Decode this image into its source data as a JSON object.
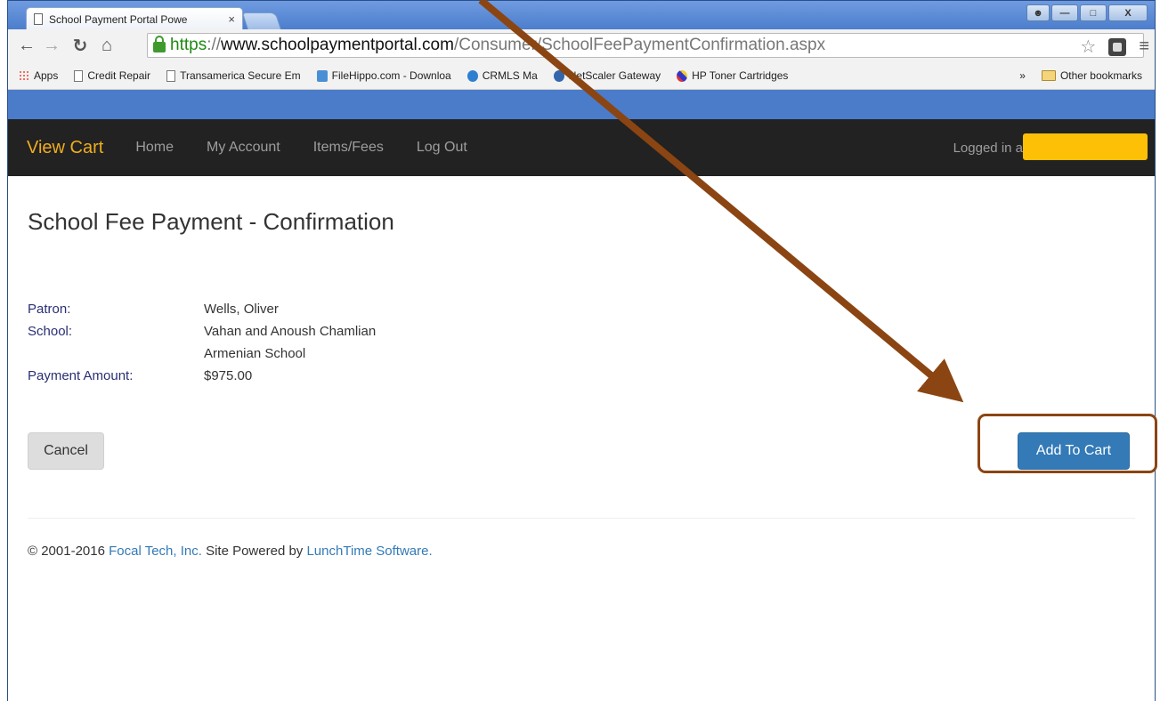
{
  "browser": {
    "tab_title": "School Payment Portal Powe",
    "tab_close": "×",
    "url_scheme": "https",
    "url_sep": "://",
    "url_host": "www.schoolpaymentportal.com",
    "url_path": "/Consumer/SchoolFeePaymentConfirmation.aspx",
    "window_buttons": [
      "—",
      "□",
      "X"
    ],
    "bookmarks": [
      {
        "label": "Apps",
        "icon": "apps-grid-icon"
      },
      {
        "label": "Credit Repair",
        "icon": "page-icon"
      },
      {
        "label": "Transamerica Secure Em",
        "icon": "page-icon"
      },
      {
        "label": "FileHippo.com - Downloa",
        "icon": "filehippo-icon"
      },
      {
        "label": "CRMLS Ma",
        "icon": "crmls-icon"
      },
      {
        "label": "NetScaler Gateway",
        "icon": "netscaler-icon"
      },
      {
        "label": "HP Toner Cartridges",
        "icon": "hp-icon"
      }
    ],
    "bookmarks_overflow": "»",
    "other_bookmarks": "Other bookmarks"
  },
  "navbar": {
    "brand": "View Cart",
    "links": [
      "Home",
      "My Account",
      "Items/Fees",
      "Log Out"
    ],
    "logged_in_label": "Logged in a",
    "brand_color": "#f0ad1e"
  },
  "page": {
    "title": "School Fee Payment - Confirmation",
    "details": [
      {
        "label": "Patron:",
        "value": "Wells, Oliver"
      },
      {
        "label": "School:",
        "value": "Vahan and Anoush Chamlian Armenian School"
      },
      {
        "label": "Payment Amount:",
        "value": "$975.00"
      }
    ],
    "cancel_label": "Cancel",
    "add_to_cart_label": "Add To Cart",
    "primary_color": "#337ab7"
  },
  "footer": {
    "prefix": "© 2001-2016 ",
    "company": "Focal Tech, Inc.",
    "middle": " Site Powered by ",
    "software": "LunchTime Software."
  },
  "annotation": {
    "arrow_color": "#8b4513",
    "highlight_target": "add-to-cart-button"
  }
}
